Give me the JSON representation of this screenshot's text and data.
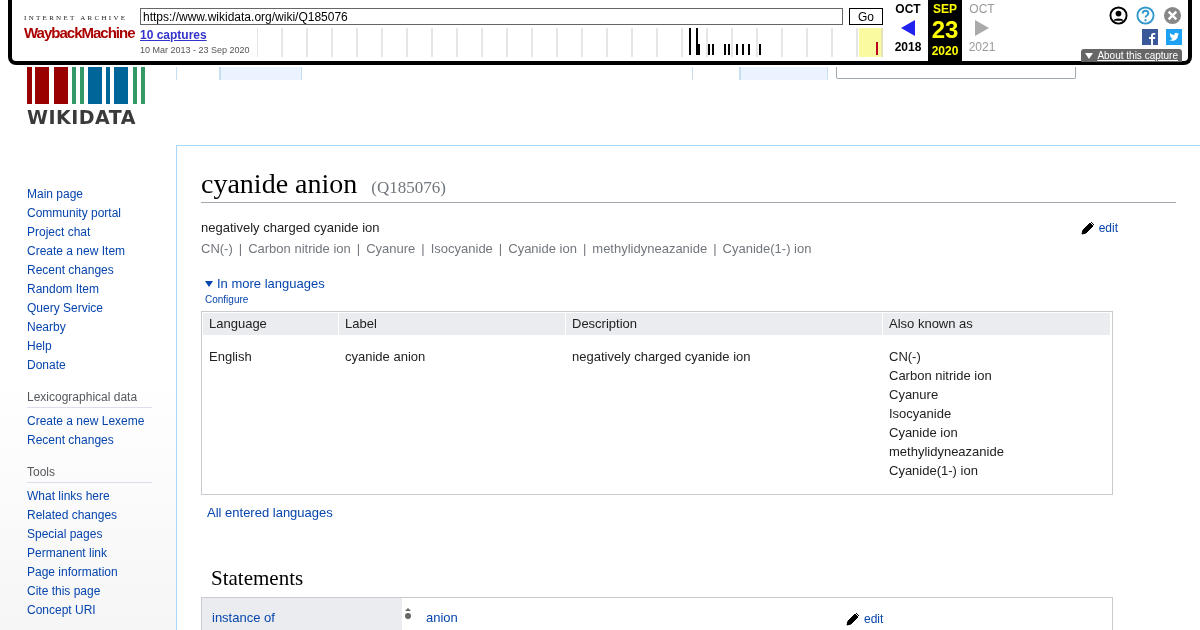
{
  "wayback": {
    "brand_top": "INTERNET ARCHIVE",
    "brand_main": "WaybackMachine",
    "url": "https://www.wikidata.org/wiki/Q185076",
    "go": "Go",
    "captures": "10 captures",
    "range": "10 Mar 2013 - 23 Sep 2020",
    "months": [
      {
        "month": "OCT",
        "year": "2018",
        "selected": false,
        "has_captures": true
      },
      {
        "month": "SEP",
        "day": "23",
        "year": "2020",
        "selected": true,
        "has_captures": true
      },
      {
        "month": "OCT",
        "year": "2021",
        "selected": false,
        "has_captures": false
      }
    ],
    "about": "About this capture"
  },
  "logo": {
    "wordmark": "WIKIDATA"
  },
  "tabs": [
    {
      "selected": true
    },
    {
      "selected": false
    },
    {
      "selected": true
    },
    {
      "selected": false
    }
  ],
  "sidebar": {
    "items": [
      "Main page",
      "Community portal",
      "Project chat",
      "Create a new Item",
      "Recent changes",
      "Random Item",
      "Query Service",
      "Nearby",
      "Help",
      "Donate"
    ],
    "sections": [
      {
        "heading": "Lexicographical data",
        "items": [
          "Create a new Lexeme",
          "Recent changes"
        ]
      },
      {
        "heading": "Tools",
        "items": [
          "What links here",
          "Related changes",
          "Special pages",
          "Permanent link",
          "Page information",
          "Cite this page",
          "Concept URI"
        ]
      }
    ]
  },
  "item": {
    "label": "cyanide anion",
    "id": "(Q185076)",
    "description": "negatively charged cyanide ion",
    "edit": "edit",
    "aliases": [
      {
        "name": "CN(-)"
      },
      {
        "separator": "|",
        "name": "Carbon nitride ion"
      },
      {
        "separator": "|",
        "name": "Cyanure"
      },
      {
        "separator": "|",
        "name": "Isocyanide"
      },
      {
        "separator": "|",
        "name": "Cyanide ion"
      },
      {
        "separator": "|",
        "name": "methylidyneazanide"
      },
      {
        "separator": "|",
        "name": "Cyanide(1-) ion"
      }
    ]
  },
  "languages": {
    "toggle": "In more languages",
    "expanded": true,
    "configure": "Configure",
    "columns": [
      "Language",
      "Label",
      "Description",
      "Also known as"
    ],
    "rows": [
      {
        "language": "English",
        "label": "cyanide anion",
        "description": "negatively charged cyanide ion",
        "aliases": [
          "CN(-)",
          "Carbon nitride ion",
          "Cyanure",
          "Isocyanide",
          "Cyanide ion",
          "methylidyneazanide",
          "Cyanide(1-) ion"
        ]
      }
    ],
    "all": "All entered languages"
  },
  "statements": {
    "heading": "Statements",
    "rows": [
      {
        "property": "instance of",
        "value": "anion",
        "edit": "edit"
      }
    ]
  }
}
